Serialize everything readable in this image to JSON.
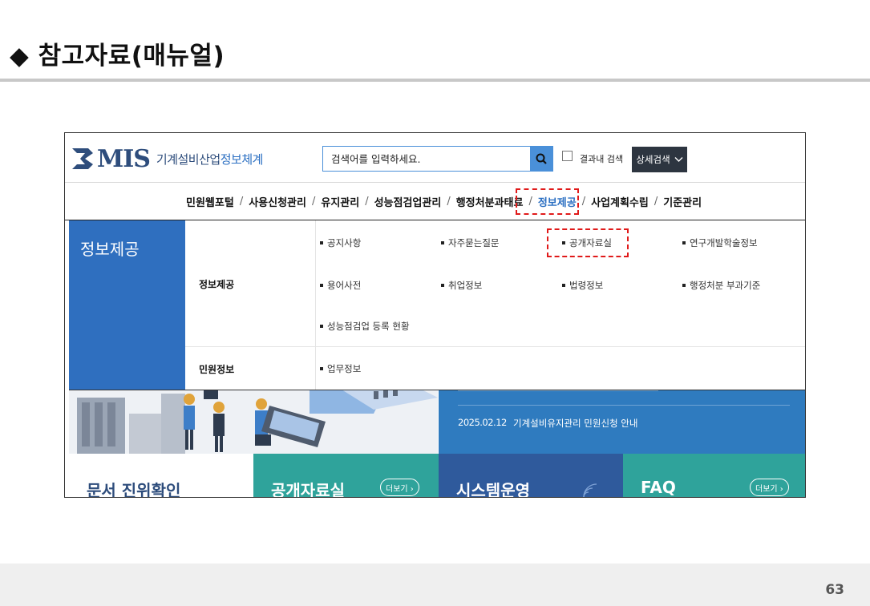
{
  "slide": {
    "title": "◆ 참고자료(매뉴얼)",
    "page_number": "63"
  },
  "header": {
    "logo_mis": "MIS",
    "logo_sub_dark": "기계설비산업",
    "logo_sub_blue": "정보체계",
    "search_placeholder": "검색어를 입력하세요.",
    "within_results_label": "결과내 검색",
    "advanced_search_label": "상세검색"
  },
  "gnb": {
    "items": [
      "민원웹포털",
      "사용신청관리",
      "유지관리",
      "성능점검업관리",
      "행정처분과태료",
      "정보제공",
      "사업계획수립",
      "기준관리"
    ],
    "separator": "/",
    "active_index": 5
  },
  "mega_menu": {
    "side_title": "정보제공",
    "categories": [
      {
        "label": "정보제공",
        "items": [
          "공지사항",
          "자주묻는질문",
          "공개자료실",
          "연구개발학술정보",
          "용어사전",
          "취업정보",
          "법령정보",
          "행정처분 부과기준",
          "성능점검업 등록 현황"
        ]
      },
      {
        "label": "민원정보",
        "items": [
          "업무정보"
        ]
      }
    ]
  },
  "notice": {
    "date": "2025.02.12",
    "text": "기계설비유지관리 민원신청 안내"
  },
  "tiles": [
    {
      "title": "문서 진위확인",
      "more": ""
    },
    {
      "title": "공개자료실",
      "more": "더보기 ›"
    },
    {
      "title": "시스템운영",
      "more": ""
    },
    {
      "title": "FAQ",
      "more": "더보기 ›"
    }
  ],
  "colors": {
    "brand_navy": "#2e4d7c",
    "menu_blue": "#2f6fbf",
    "search_blue": "#4a90d9",
    "highlight_red": "#e01a1a",
    "tile_teal": "#2fa39b",
    "tile_navy": "#2f5a9c"
  }
}
